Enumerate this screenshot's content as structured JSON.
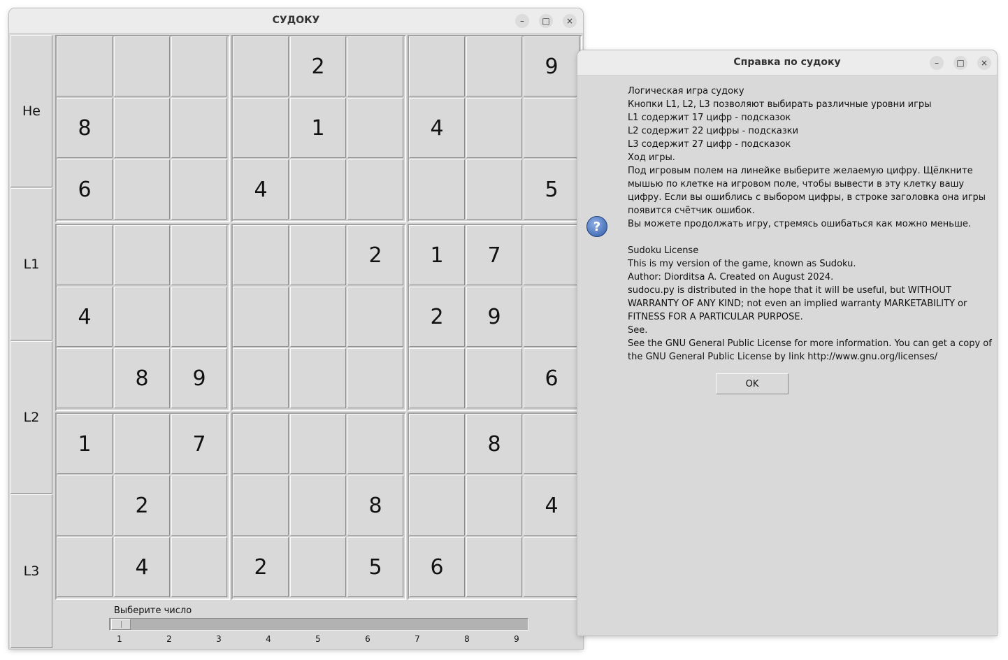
{
  "sudoku_window": {
    "title": "СУДОКУ",
    "levels": [
      "Не",
      "L1",
      "L2",
      "L3"
    ],
    "grid": [
      [
        "",
        "",
        "",
        "",
        "2",
        "",
        "",
        "",
        "9"
      ],
      [
        "8",
        "",
        "",
        "",
        "1",
        "",
        "4",
        "",
        ""
      ],
      [
        "6",
        "",
        "",
        "4",
        "",
        "",
        "",
        "",
        "5"
      ],
      [
        "",
        "",
        "",
        "",
        "",
        "2",
        "1",
        "7",
        ""
      ],
      [
        "4",
        "",
        "",
        "",
        "",
        "",
        "2",
        "9",
        ""
      ],
      [
        "",
        "8",
        "9",
        "",
        "",
        "",
        "",
        "",
        "6"
      ],
      [
        "1",
        "",
        "7",
        "",
        "",
        "",
        "",
        "8",
        ""
      ],
      [
        "",
        "2",
        "",
        "",
        "",
        "8",
        "",
        "",
        "4"
      ],
      [
        "",
        "4",
        "",
        "2",
        "",
        "5",
        "6",
        "",
        ""
      ]
    ],
    "slider": {
      "label": "Выберите число",
      "ticks": [
        "1",
        "2",
        "3",
        "4",
        "5",
        "6",
        "7",
        "8",
        "9"
      ],
      "value": 1
    },
    "controls": {
      "minimize": "–",
      "maximize": "□",
      "close": "×"
    }
  },
  "help_window": {
    "title": "Справка по судоку",
    "icon": "question-icon",
    "lines": [
      "Логическая игра судоку",
      "Кнопки L1, L2, L3 позволяют выбирать различные уровни игры",
      "L1 содержит 17 цифр - подсказок",
      "L2 содержит 22 цифры - подсказки",
      "L3 содержит 27 цифр - подсказок",
      "Ход игры.",
      "Под игровым полем на линейке выберите желаемую цифру. Щёлкните",
      "мышью по клетке на игровом поле, чтобы вывести в эту клетку вашу",
      "цифру. Если вы ошиблись с выбором цифры, в строке заголовка она игры",
      "появится счётчик ошибок.",
      "Вы можете продолжать игру, стремясь ошибаться как можно меньше.",
      "",
      "Sudoku License",
      "This is my version of the game, known as Sudoku.",
      "Author: Diorditsa A. Created on August 2024.",
      "sudocu.py is distributed in the hope that it will be useful, but WITHOUT",
      "WARRANTY OF ANY KIND; not even an implied warranty MARKETABILITY or",
      "FITNESS FOR A PARTICULAR PURPOSE.",
      "See.",
      "See the GNU General Public License for more information. You can get a copy of",
      "the GNU General Public License by link http://www.gnu.org/licenses/"
    ],
    "ok_label": "OK",
    "controls": {
      "minimize": "–",
      "maximize": "□",
      "close": "×"
    }
  }
}
